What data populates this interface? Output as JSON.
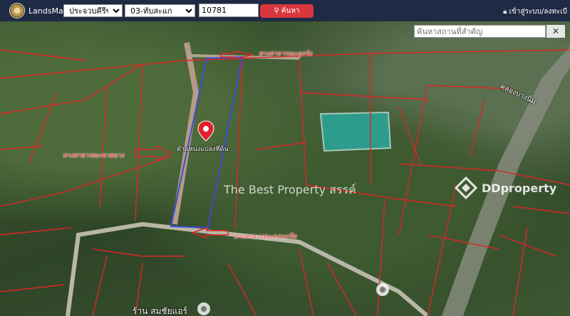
{
  "header": {
    "brand": "LandsMaps",
    "province": "ประจวบคีรีขันธ์",
    "district": "03-ทับสะแก",
    "parcel_number": "10781",
    "search_label": "ค้นหา",
    "login_label": "เข้าสู่ระบบ/ลงทะเบี"
  },
  "map": {
    "place_search_placeholder": "ค้นหาสถานที่สำคัญ",
    "clear_label": "✕",
    "labels": {
      "road_top": "ทางสาธารณะลูกรัง",
      "road_left": "ทางสาธารณะพาดยาง",
      "road_bottom": "ทางสาธารณะคอนกรีต",
      "parcel_location": "ตำแหน่งแปลงที่ดิน",
      "canal": "คลองบางนิ่ม",
      "shop": "ร้าน สมชัยแอร์"
    },
    "watermark": "The Best Property สรรค์",
    "logo_text": "DDproperty",
    "colors": {
      "parcel_lines": "#e02424",
      "selected_parcel": "#3a4bd6",
      "marker": "#e0202a"
    }
  }
}
